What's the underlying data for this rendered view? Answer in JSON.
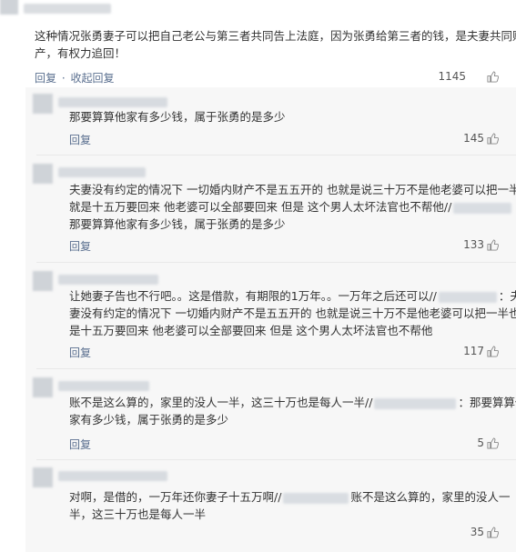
{
  "comment_main": {
    "text_lines": [
      "这种情况张勇妻子可以把自己老公与第三者共同告上法庭，因为张勇给第三者的钱，是夫妻共同财",
      "产，有权力追回！"
    ],
    "actions": {
      "reply": "回复",
      "separator": "·",
      "collapse": "收起回复"
    },
    "likes": "1145"
  },
  "replies": [
    {
      "lines": [
        "那要算算他家有多少钱，属于张勇的是多少"
      ],
      "reply_label": "回复",
      "likes": "145"
    },
    {
      "lines": [
        "夫妻没有约定的情况下 一切婚内财产不是五五开的 也就是说三十万不是他老婆可以把一半也",
        "就是十五万要回来 他老婆可以全部要回来 但是 这个男人太坏法官也不帮他//",
        "那要算算他家有多少钱，属于张勇的是多少"
      ],
      "reply_label": "回复",
      "likes": "133"
    },
    {
      "lines": [
        "让她妻子告也不行吧。。这是借款，有期限的1万年。。一万年之后还可以//",
        "：夫",
        "妻没有约定的情况下 一切婚内财产不是五五开的 也就是说三十万不是他老婆可以把一半也就",
        "是十五万要回来 他老婆可以全部要回来 但是 这个男人太坏法官也不帮他"
      ],
      "reply_label": "回复",
      "likes": "117"
    },
    {
      "lines": [
        "账不是这么算的，家里的没人一半，这三十万也是每人一半//",
        "：那要算算他",
        "家有多少钱，属于张勇的是多少"
      ],
      "reply_label": "回复",
      "likes": "5"
    },
    {
      "lines": [
        "对啊，是借的，一万年还你妻子十五万啊//",
        "账不是这么算的，家里的没人一",
        "半，这三十万也是每人一半"
      ],
      "reply_label": "回复",
      "likes": "35"
    }
  ],
  "colors": {
    "link": "#5a6f8f",
    "text": "#333333",
    "panel": "#f7f7f7"
  },
  "icons": [
    "thumb-up-icon"
  ]
}
